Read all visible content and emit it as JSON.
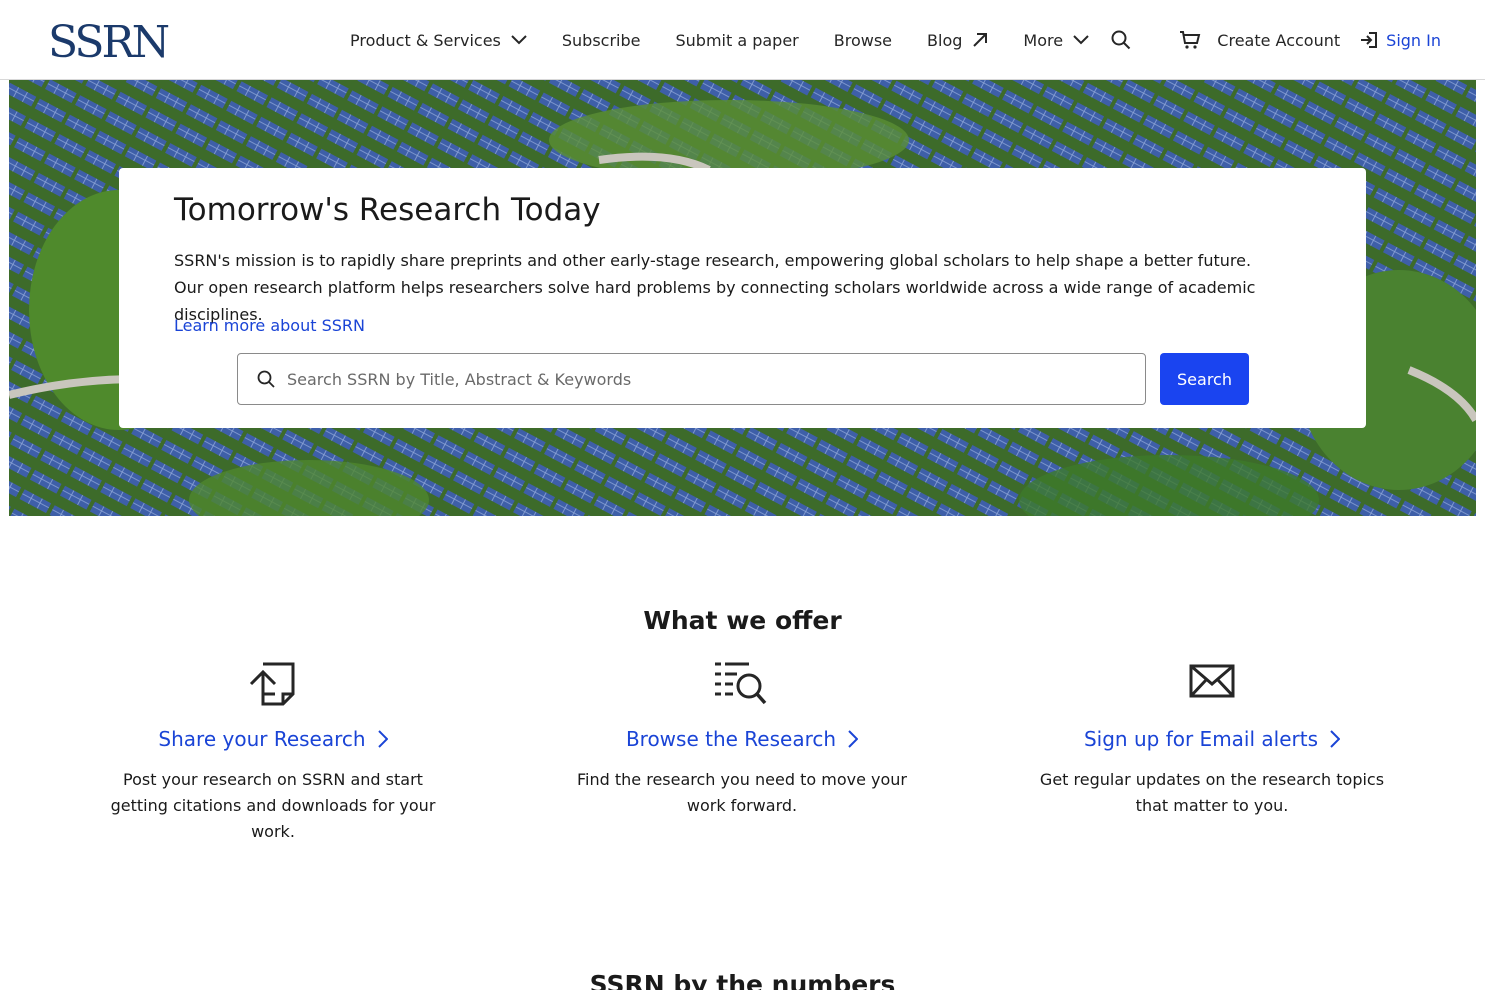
{
  "header": {
    "logo_text": "SSRN",
    "nav": [
      {
        "label": "Product & Services",
        "icon": "chevron-down-icon"
      },
      {
        "label": "Subscribe"
      },
      {
        "label": "Submit a paper"
      },
      {
        "label": "Browse"
      },
      {
        "label": "Blog",
        "icon": "external-arrow-icon"
      },
      {
        "label": "More",
        "icon": "chevron-down-icon"
      }
    ],
    "create_account": "Create Account",
    "sign_in": "Sign In"
  },
  "hero": {
    "title": "Tomorrow's Research Today",
    "text": "SSRN's mission is to rapidly share preprints and other early-stage research, empowering global scholars to help shape a better future. Our open research platform helps researchers solve hard problems by connecting scholars worldwide across a wide range of academic disciplines.",
    "link": "Learn more about SSRN",
    "search_placeholder": "Search SSRN by Title, Abstract & Keywords",
    "search_button": "Search"
  },
  "offer": {
    "title": "What we offer",
    "items": [
      {
        "icon": "upload-document-icon",
        "label": "Share your Research",
        "desc": "Post your research on SSRN and start getting citations and downloads for your work."
      },
      {
        "icon": "browse-list-search-icon",
        "label": "Browse the Research",
        "desc": "Find the research you need to move your work forward."
      },
      {
        "icon": "envelope-icon",
        "label": "Sign up for Email alerts",
        "desc": "Get regular updates on the research topics that matter to you."
      }
    ]
  },
  "numbers": {
    "title": "SSRN by the numbers"
  },
  "colors": {
    "link": "#1a44d6",
    "button": "#1a44f0",
    "logo": "#1b3a6b"
  }
}
